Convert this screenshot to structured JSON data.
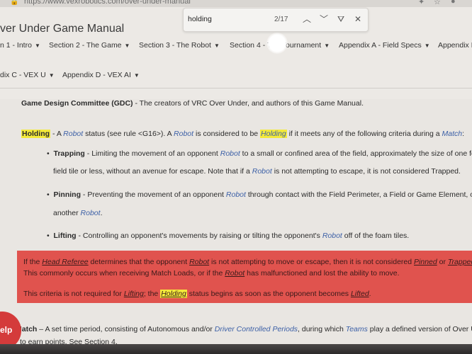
{
  "browser": {
    "url": "https://www.vexrobotics.com/over-under-manual"
  },
  "find": {
    "query": "holding",
    "count": "2/17",
    "prev_icon": "chevron-up-icon",
    "next_icon": "chevron-down-icon",
    "filter_icon": "filter-icon",
    "close_icon": "close-icon"
  },
  "header": {
    "title": "ver Under Game Manual"
  },
  "nav": {
    "row1": [
      "n 1 - Intro",
      "Section 2 - The Game",
      "Section 3 - The Robot",
      "Section 4 - The Tournament",
      "Appendix A - Field Specs",
      "Appendix B"
    ],
    "row2": [
      "dix C - VEX U",
      "Appendix D - VEX AI"
    ]
  },
  "content": {
    "gdc_term": "Game Design Committee (GDC)",
    "gdc_def": " - The creators of VRC Over Under, and authors of this Game Manual.",
    "holding": {
      "term": "Holding",
      "t1": " - A ",
      "robot1": "Robot",
      "t2": " status (see rule <G16>). A ",
      "robot2": "Robot",
      "t3": " is considered to be ",
      "holding2": "Holding",
      "t4": " if it meets any of the following criteria during a ",
      "match": "Match",
      "t5": ":"
    },
    "trapping": {
      "term": "Trapping",
      "t1": " - Limiting the movement of an opponent ",
      "robot": "Robot",
      "t2": " to a small or confined area of the field, approximately the size of one foam",
      "l2a": "field tile or less, without an avenue for escape. Note that if a ",
      "robot2": "Robot",
      "l2b": " is not attempting to escape, it is not considered Trapped."
    },
    "pinning": {
      "term": "Pinning",
      "t1": " - Preventing the movement of an opponent ",
      "robot": "Robot",
      "t2": " through contact with the Field Perimeter, a Field or Game Element, or",
      "l2a": "another ",
      "robot2": "Robot",
      "l2b": "."
    },
    "lifting": {
      "term": "Lifting",
      "t1": " - Controlling an opponent's movements by raising or tilting the opponent's ",
      "robot": "Robot",
      "t2": " off of the foam tiles."
    },
    "note": {
      "l1a": "If the ",
      "head_ref": "Head Referee",
      "l1b": " determines that the opponent ",
      "robot": "Robot",
      "l1c": " is not attempting to move or escape, then it is not considered ",
      "pinned": "Pinned",
      "l1d": " or ",
      "trapped": "Trapped",
      "l1e": ".",
      "l2a": "This commonly occurs when receiving Match Loads, or if the ",
      "robot2": "Robot",
      "l2b": " has malfunctioned and lost the ability to move.",
      "l3a": "This criteria is not required for ",
      "lifting": "Lifting",
      "l3b": "; the ",
      "holding": "Holding",
      "l3c": " status begins as soon as the opponent becomes ",
      "lifted": "Lifted",
      "l3d": "."
    },
    "match": {
      "term": "Match",
      "t1": " – A set time period, consisting of Autonomous and/or ",
      "dcp": "Driver Controlled Periods",
      "t2": ", during which ",
      "teams": "Teams",
      "t3": " play a defined version of Over Unde",
      "l2": "to earn points. See Section 4."
    }
  },
  "help": {
    "label": "elp"
  },
  "colors": {
    "highlight": "#f4ea3a",
    "note_bg": "#e0534e",
    "link": "#3b5fa6",
    "help_bg": "#d43b3b"
  }
}
